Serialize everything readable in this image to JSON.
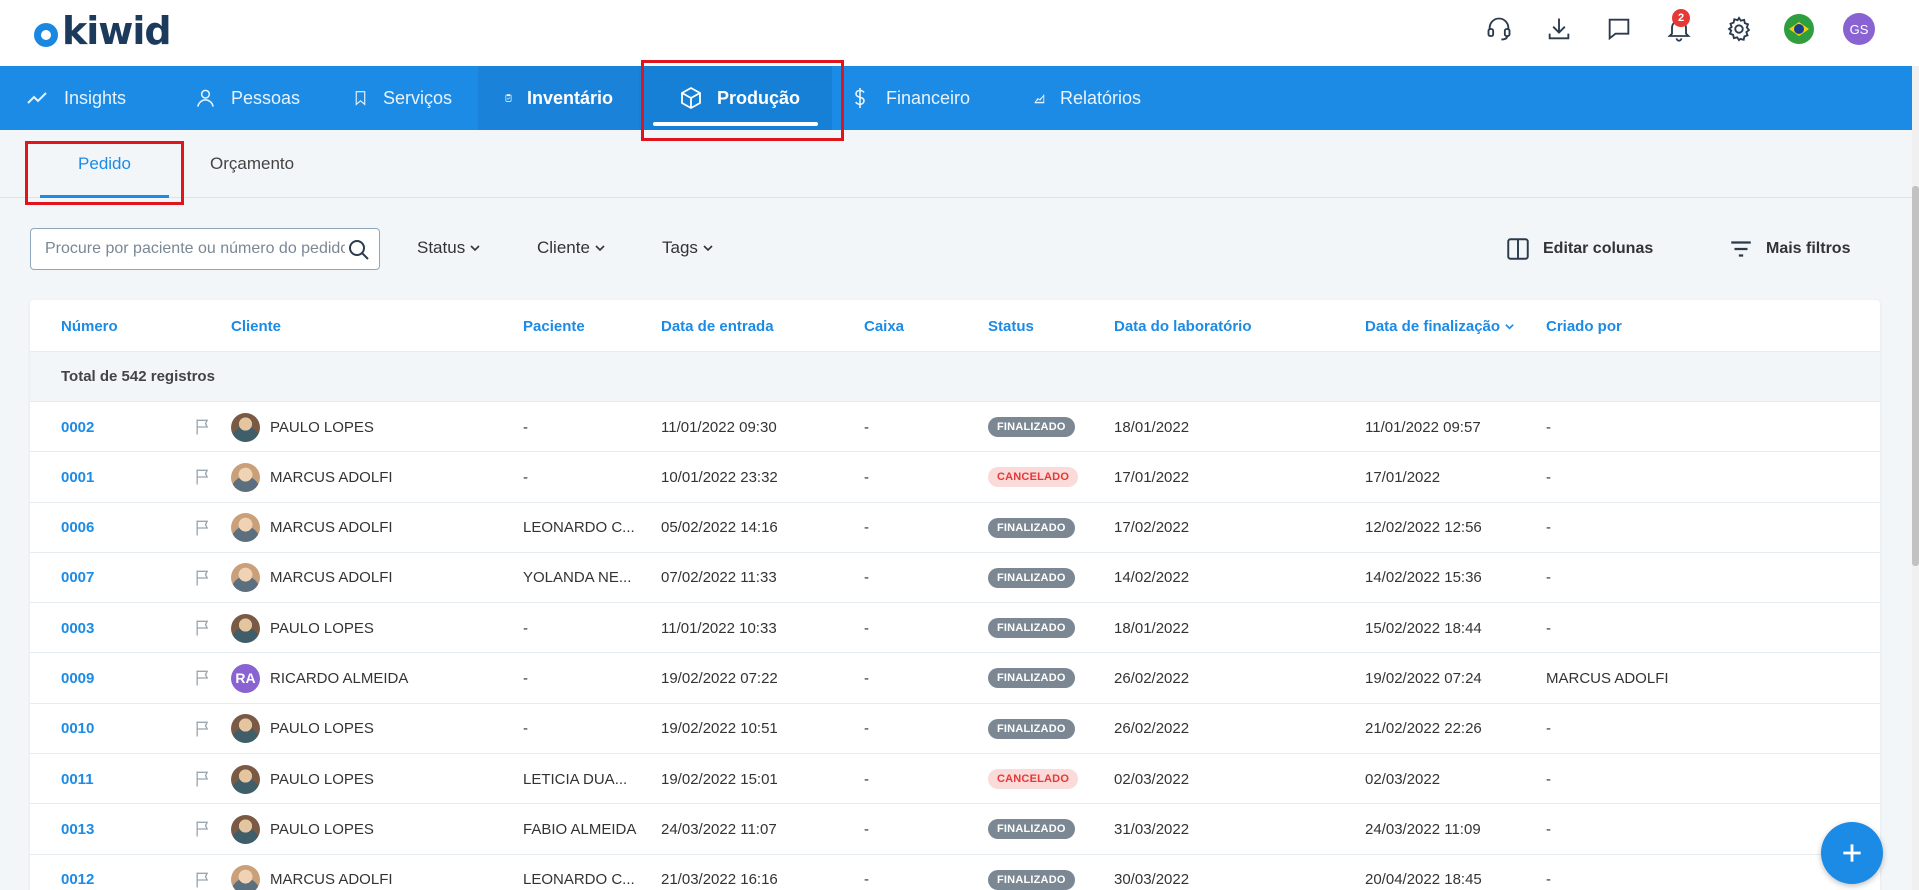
{
  "header": {
    "logo_text": "kiwid",
    "notification_count": "2",
    "avatar_initials": "GS",
    "icons": [
      "headset-icon",
      "download-icon",
      "chat-icon",
      "bell-icon",
      "gear-icon",
      "brazil-flag-icon"
    ]
  },
  "nav": {
    "items": [
      {
        "label": "Insights",
        "icon": "chart-line-icon"
      },
      {
        "label": "Pessoas",
        "icon": "person-icon"
      },
      {
        "label": "Serviços",
        "icon": "bookmark-icon"
      },
      {
        "label": "Inventário",
        "icon": "clipboard-check-icon"
      },
      {
        "label": "Produção",
        "icon": "box-icon"
      },
      {
        "label": "Financeiro",
        "icon": "dollar-icon"
      },
      {
        "label": "Relatórios",
        "icon": "area-chart-icon"
      }
    ],
    "active": "Produção"
  },
  "subtabs": {
    "items": [
      "Pedido",
      "Orçamento"
    ],
    "active": "Pedido"
  },
  "filters": {
    "search_placeholder": "Procure por paciente ou número do pedido",
    "status_label": "Status",
    "cliente_label": "Cliente",
    "tags_label": "Tags",
    "edit_columns_label": "Editar colunas",
    "more_filters_label": "Mais filtros"
  },
  "table": {
    "columns": [
      "Número",
      "Cliente",
      "Paciente",
      "Data de entrada",
      "Caixa",
      "Status",
      "Data do laboratório",
      "Data de finalização",
      "Criado por"
    ],
    "total_label": "Total de 542 registros",
    "rows": [
      {
        "numero": "0002",
        "cliente": "PAULO LOPES",
        "avatar": "photo",
        "paciente": "-",
        "entrada": "11/01/2022 09:30",
        "caixa": "-",
        "status": "FINALIZADO",
        "status_type": "fin",
        "laboratorio": "18/01/2022",
        "finalizacao": "11/01/2022 09:57",
        "criado": "-"
      },
      {
        "numero": "0001",
        "cliente": "MARCUS ADOLFI",
        "avatar": "photo2",
        "paciente": "-",
        "entrada": "10/01/2022 23:32",
        "caixa": "-",
        "status": "CANCELADO",
        "status_type": "can",
        "laboratorio": "17/01/2022",
        "finalizacao": "17/01/2022",
        "criado": "-"
      },
      {
        "numero": "0006",
        "cliente": "MARCUS ADOLFI",
        "avatar": "photo2",
        "paciente": "LEONARDO C...",
        "entrada": "05/02/2022 14:16",
        "caixa": "-",
        "status": "FINALIZADO",
        "status_type": "fin",
        "laboratorio": "17/02/2022",
        "finalizacao": "12/02/2022 12:56",
        "criado": "-"
      },
      {
        "numero": "0007",
        "cliente": "MARCUS ADOLFI",
        "avatar": "photo2",
        "paciente": "YOLANDA NE...",
        "entrada": "07/02/2022 11:33",
        "caixa": "-",
        "status": "FINALIZADO",
        "status_type": "fin",
        "laboratorio": "14/02/2022",
        "finalizacao": "14/02/2022 15:36",
        "criado": "-"
      },
      {
        "numero": "0003",
        "cliente": "PAULO LOPES",
        "avatar": "photo",
        "paciente": "-",
        "entrada": "11/01/2022 10:33",
        "caixa": "-",
        "status": "FINALIZADO",
        "status_type": "fin",
        "laboratorio": "18/01/2022",
        "finalizacao": "15/02/2022 18:44",
        "criado": "-"
      },
      {
        "numero": "0009",
        "cliente": "RICARDO ALMEIDA",
        "avatar": "RA",
        "paciente": "-",
        "entrada": "19/02/2022 07:22",
        "caixa": "-",
        "status": "FINALIZADO",
        "status_type": "fin",
        "laboratorio": "26/02/2022",
        "finalizacao": "19/02/2022 07:24",
        "criado": "MARCUS ADOLFI"
      },
      {
        "numero": "0010",
        "cliente": "PAULO LOPES",
        "avatar": "photo",
        "paciente": "-",
        "entrada": "19/02/2022 10:51",
        "caixa": "-",
        "status": "FINALIZADO",
        "status_type": "fin",
        "laboratorio": "26/02/2022",
        "finalizacao": "21/02/2022 22:26",
        "criado": "-"
      },
      {
        "numero": "0011",
        "cliente": "PAULO LOPES",
        "avatar": "photo",
        "paciente": "LETICIA DUA...",
        "entrada": "19/02/2022 15:01",
        "caixa": "-",
        "status": "CANCELADO",
        "status_type": "can",
        "laboratorio": "02/03/2022",
        "finalizacao": "02/03/2022",
        "criado": "-"
      },
      {
        "numero": "0013",
        "cliente": "PAULO LOPES",
        "avatar": "photo",
        "paciente": "FABIO ALMEIDA",
        "entrada": "24/03/2022 11:07",
        "caixa": "-",
        "status": "FINALIZADO",
        "status_type": "fin",
        "laboratorio": "31/03/2022",
        "finalizacao": "24/03/2022 11:09",
        "criado": "-"
      },
      {
        "numero": "0012",
        "cliente": "MARCUS ADOLFI",
        "avatar": "photo2",
        "paciente": "LEONARDO C...",
        "entrada": "21/03/2022 16:16",
        "caixa": "-",
        "status": "FINALIZADO",
        "status_type": "fin",
        "laboratorio": "30/03/2022",
        "finalizacao": "20/04/2022 18:45",
        "criado": "-"
      }
    ]
  },
  "colors": {
    "primary": "#1c8be6",
    "highlight": "#e0141d",
    "finalizado": "#7b8792",
    "cancelado_bg": "#fbdada",
    "cancelado_text": "#e53935"
  }
}
